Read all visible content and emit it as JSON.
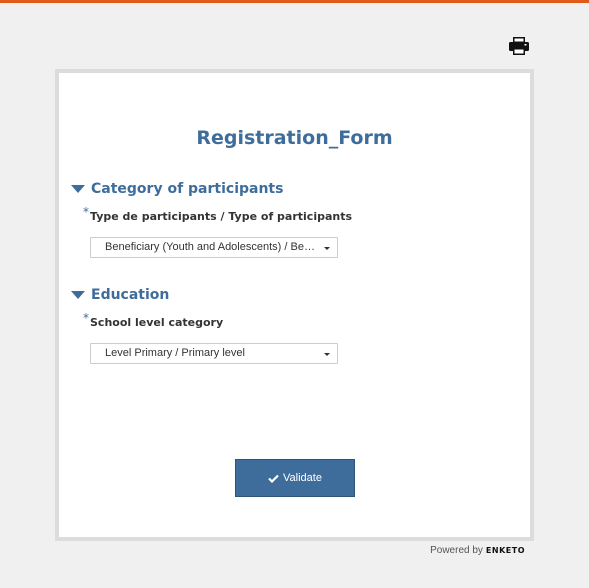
{
  "header": {
    "accent_color": "#e05a1a",
    "print_icon": "printer-icon"
  },
  "form": {
    "title": "Registration_Form",
    "groups": [
      {
        "label": "Category of participants",
        "questions": [
          {
            "required_mark": "*",
            "label": "Type de participants / Type of participants",
            "selected_value": "Beneficiary (Youth and Adolescents) / Beneficiary (Youth and Adolescents)"
          }
        ]
      },
      {
        "label": "Education",
        "questions": [
          {
            "required_mark": "*",
            "label": "School level category",
            "selected_value": "Level Primary / Primary level"
          }
        ]
      }
    ],
    "validate_label": "Validate",
    "validate_icon": "check-icon"
  },
  "footer": {
    "powered_by": "Powered by",
    "brand": "ENKETO"
  },
  "colors": {
    "primary": "#3e6d9c",
    "background": "#f0f0f0",
    "card": "#ffffff"
  }
}
